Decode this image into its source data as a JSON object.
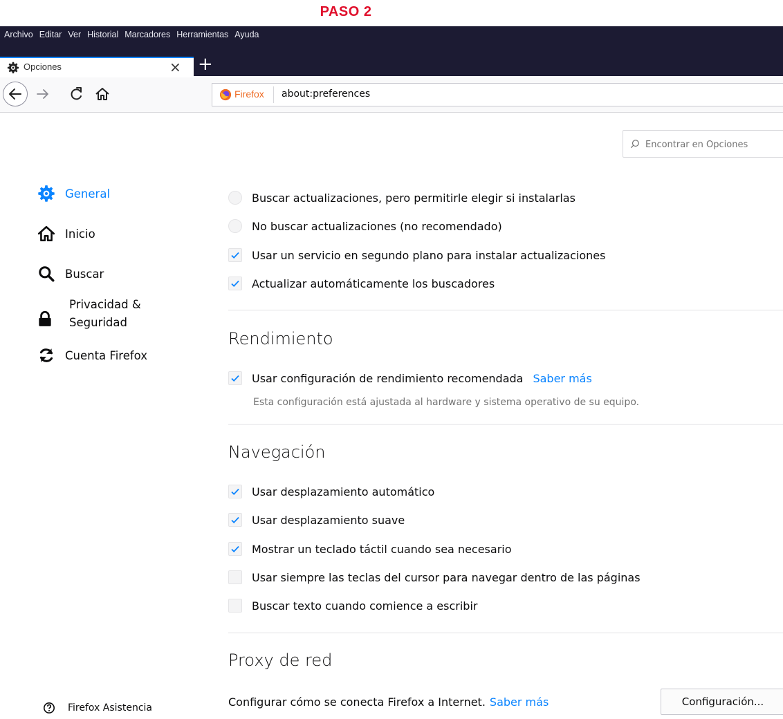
{
  "caption": "PASO 2",
  "menubar": [
    "Archivo",
    "Editar",
    "Ver",
    "Historial",
    "Marcadores",
    "Herramientas",
    "Ayuda"
  ],
  "tab": {
    "title": "Opciones",
    "close": "×",
    "new_tab": "+"
  },
  "urlbar": {
    "identity": "Firefox",
    "url": "about:preferences"
  },
  "search": {
    "placeholder": "Encontrar en Opciones"
  },
  "sidebar": {
    "items": [
      {
        "label": "General",
        "icon": "gear-icon",
        "selected": true
      },
      {
        "label": "Inicio",
        "icon": "home-icon"
      },
      {
        "label": "Buscar",
        "icon": "search-icon"
      },
      {
        "label_line1": "Privacidad &",
        "label_line2": "Seguridad",
        "icon": "lock-icon"
      },
      {
        "label": "Cuenta Firefox",
        "icon": "sync-icon"
      }
    ],
    "support": {
      "label": "Firefox Asistencia",
      "icon": "help-icon"
    }
  },
  "updates": {
    "opt_ask": "Buscar actualizaciones, pero permitirle elegir si instalarlas",
    "opt_never": "No buscar actualizaciones (no recomendado)",
    "background_service": "Usar un servicio en segundo plano para instalar actualizaciones",
    "auto_search_engines": "Actualizar automáticamente los buscadores"
  },
  "performance": {
    "heading": "Rendimiento",
    "recommended": "Usar configuración de rendimiento recomendada",
    "learn_more": "Saber más",
    "hint": "Esta configuración está ajustada al hardware y sistema operativo de su equipo."
  },
  "browsing": {
    "heading": "Navegación",
    "autoscroll": "Usar desplazamiento automático",
    "smooth_scroll": "Usar desplazamiento suave",
    "touch_keyboard": "Mostrar un teclado táctil cuando sea necesario",
    "caret_browsing": "Usar siempre las teclas del cursor para navegar dentro de las páginas",
    "find_as_type": "Buscar texto cuando comience a escribir"
  },
  "proxy": {
    "heading": "Proxy de red",
    "description": "Configurar cómo se conecta Firefox a Internet.",
    "learn_more": "Saber más",
    "button": "Configuración..."
  },
  "colors": {
    "accent": "#0a84ff",
    "titlebar": "#1c1b33",
    "caption": "#e0102c"
  }
}
